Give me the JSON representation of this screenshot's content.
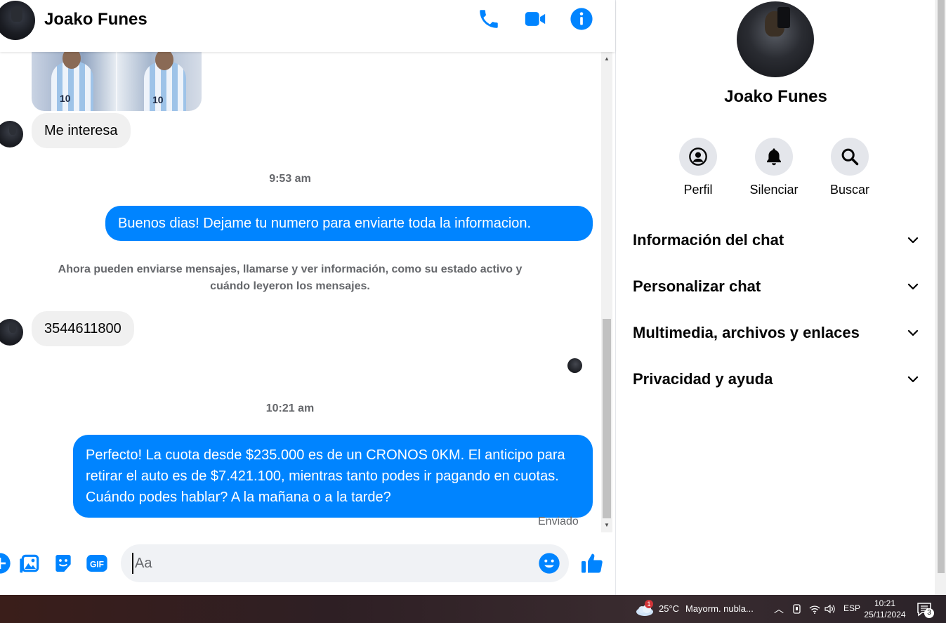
{
  "header": {
    "contact_name": "Joako Funes"
  },
  "messages": {
    "msg1": "Me interesa",
    "time1": "9:53 am",
    "msg2": "Buenos dias! Dejame tu numero para enviarte toda la informacion.",
    "system_note": "Ahora pueden enviarse mensajes, llamarse y ver información, como su estado activo y cuándo leyeron los mensajes.",
    "msg3": "3544611800",
    "time2": "10:21 am",
    "msg4": "Perfecto! La cuota desde $235.000 es de un CRONOS 0KM. El anticipo para retirar el auto es de $7.421.100, mientras tanto podes ir pagando en cuotas. Cuándo podes hablar? A la mañana o a la tarde?",
    "status": "Enviado"
  },
  "composer": {
    "placeholder": "Aa",
    "gif_label": "GIF"
  },
  "panel": {
    "name": "Joako Funes",
    "actions": [
      {
        "label": "Perfil",
        "icon": "profile-icon"
      },
      {
        "label": "Silenciar",
        "icon": "bell-icon"
      },
      {
        "label": "Buscar",
        "icon": "search-icon"
      }
    ],
    "sections": [
      {
        "label": "Información del chat"
      },
      {
        "label": "Personalizar chat"
      },
      {
        "label": "Multimedia, archivos y enlaces"
      },
      {
        "label": "Privacidad y ayuda"
      }
    ]
  },
  "image_preview": {
    "jersey_number": "10"
  },
  "taskbar": {
    "weather_badge": "1",
    "temperature": "25°C",
    "weather_desc": "Mayorm. nubla...",
    "language": "ESP",
    "time": "10:21",
    "date": "25/11/2024",
    "notification_count": "3"
  },
  "colors": {
    "accent": "#0084ff",
    "bubble_in": "#f0f0f0",
    "panel_button": "#e4e6eb"
  }
}
